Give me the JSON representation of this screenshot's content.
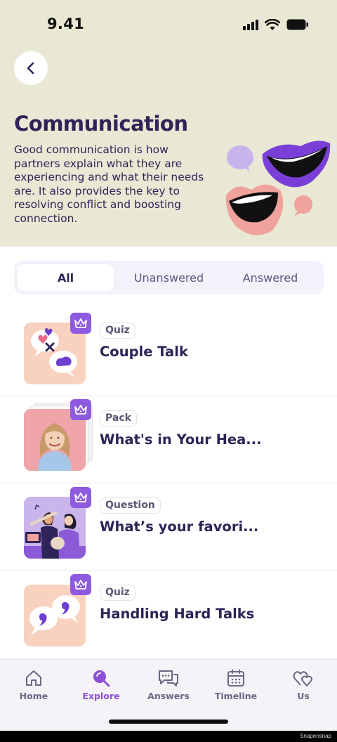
{
  "status_bar": {
    "time": "9.41"
  },
  "header": {
    "title": "Communication",
    "description": "Good communication is how partners explain what they are experiencing and what their needs are. It also provides the key to resolving conflict and boosting connection."
  },
  "segments": [
    {
      "label": "All",
      "active": true
    },
    {
      "label": "Unanswered",
      "active": false
    },
    {
      "label": "Answered",
      "active": false
    }
  ],
  "items": [
    {
      "tag": "Quiz",
      "title": "Couple Talk",
      "thumb": "chat-bubbles-hearts",
      "premium_icon": "crown-icon"
    },
    {
      "tag": "Pack",
      "title": "What's in Your Hea...",
      "thumb": "woman-portrait-stack",
      "premium_icon": "crown-icon"
    },
    {
      "tag": "Question",
      "title": "What’s your favori...",
      "thumb": "couple-music",
      "premium_icon": "crown-icon"
    },
    {
      "tag": "Quiz",
      "title": "Handling Hard Talks",
      "thumb": "quote-bubbles",
      "premium_icon": "crown-icon"
    }
  ],
  "tabbar": [
    {
      "label": "Home",
      "icon": "house-icon",
      "active": false
    },
    {
      "label": "Explore",
      "icon": "search-icon",
      "active": true
    },
    {
      "label": "Answers",
      "icon": "chat-icon",
      "active": false
    },
    {
      "label": "Timeline",
      "icon": "calendar-icon",
      "active": false
    },
    {
      "label": "Us",
      "icon": "hearts-icon",
      "active": false
    }
  ],
  "watermark": "Snapensnap",
  "colors": {
    "header_bg": "#e9e8d4",
    "primary": "#2e2457",
    "accent": "#8e5ae0",
    "tab_active": "#8e4fd8"
  }
}
